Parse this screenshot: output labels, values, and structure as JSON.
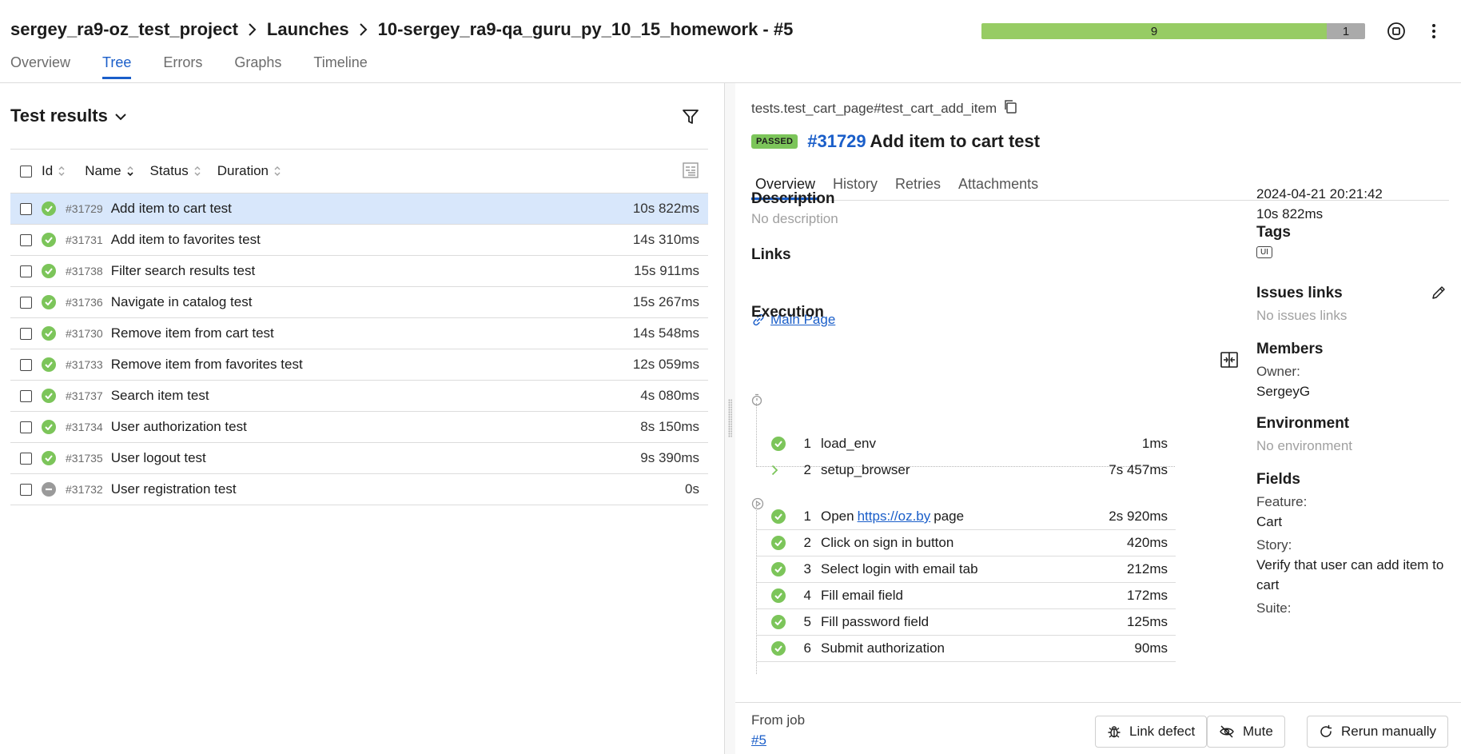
{
  "breadcrumb": {
    "project": "sergey_ra9-oz_test_project",
    "section": "Launches",
    "launch": "10-sergey_ra9-qa_guru_py_10_15_homework - #5"
  },
  "top_tabs": [
    "Overview",
    "Tree",
    "Errors",
    "Graphs",
    "Timeline"
  ],
  "active_top_tab": "Tree",
  "summary": {
    "passed": "9",
    "skipped": "1",
    "passed_fraction": 0.9,
    "skipped_fraction": 0.1
  },
  "colors": {
    "passed": "#97cc64",
    "skipped": "#aaaaaa",
    "accent": "#1a5ec9",
    "selected_row": "#d8e7fb"
  },
  "left": {
    "title": "Test results",
    "columns": [
      "Id",
      "Name",
      "Status",
      "Duration"
    ],
    "rows": [
      {
        "id": "#31729",
        "name": "Add item to cart test",
        "duration": "10s 822ms",
        "status": "passed"
      },
      {
        "id": "#31731",
        "name": "Add item to favorites test",
        "duration": "14s 310ms",
        "status": "passed"
      },
      {
        "id": "#31738",
        "name": "Filter search results test",
        "duration": "15s 911ms",
        "status": "passed"
      },
      {
        "id": "#31736",
        "name": "Navigate in catalog test",
        "duration": "15s 267ms",
        "status": "passed"
      },
      {
        "id": "#31730",
        "name": "Remove item from cart test",
        "duration": "14s 548ms",
        "status": "passed"
      },
      {
        "id": "#31733",
        "name": "Remove item from favorites test",
        "duration": "12s 059ms",
        "status": "passed"
      },
      {
        "id": "#31737",
        "name": "Search item test",
        "duration": "4s 080ms",
        "status": "passed"
      },
      {
        "id": "#31734",
        "name": "User authorization test",
        "duration": "8s 150ms",
        "status": "passed"
      },
      {
        "id": "#31735",
        "name": "User logout test",
        "duration": "9s 390ms",
        "status": "passed"
      },
      {
        "id": "#31732",
        "name": "User registration test",
        "duration": "0s",
        "status": "skipped"
      }
    ]
  },
  "detail": {
    "path": "tests.test_cart_page#test_cart_add_item",
    "status_badge": "PASSED",
    "id": "#31729",
    "name": "Add item to cart test",
    "tabs": [
      "Overview",
      "History",
      "Retries",
      "Attachments"
    ],
    "description_title": "Description",
    "description": "No description",
    "links_title": "Links",
    "link_label": "Main Page",
    "execution_title": "Execution",
    "setup_steps": [
      {
        "num": "1",
        "name": "load_env",
        "duration": "1ms"
      },
      {
        "num": "2",
        "name": "setup_browser",
        "duration": "7s 457ms"
      }
    ],
    "test_steps": [
      {
        "num": "1",
        "pre": "Open",
        "link": "https://oz.by",
        "post": "page",
        "duration": "2s 920ms"
      },
      {
        "num": "2",
        "name": "Click on sign in button",
        "duration": "420ms"
      },
      {
        "num": "3",
        "name": "Select login with email tab",
        "duration": "212ms"
      },
      {
        "num": "4",
        "name": "Fill email field",
        "duration": "172ms"
      },
      {
        "num": "5",
        "name": "Fill password field",
        "duration": "125ms"
      },
      {
        "num": "6",
        "name": "Submit authorization",
        "duration": "90ms"
      }
    ],
    "meta": {
      "date": "2024-04-21 20:21:42",
      "duration": "10s 822ms",
      "tags_title": "Tags",
      "tag": "UI",
      "issues_title": "Issues links",
      "issues": "No issues links",
      "members_title": "Members",
      "owner_label": "Owner:",
      "owner": "SergeyG",
      "environment_title": "Environment",
      "environment": "No environment",
      "fields_title": "Fields",
      "feature_label": "Feature:",
      "feature": "Cart",
      "story_label": "Story:",
      "story": "Verify that user can add item to cart",
      "suite_label": "Suite:"
    }
  },
  "footer": {
    "from_job_label": "From job",
    "job": "#5",
    "link_defect": "Link defect",
    "mute": "Mute",
    "rerun": "Rerun manually"
  }
}
